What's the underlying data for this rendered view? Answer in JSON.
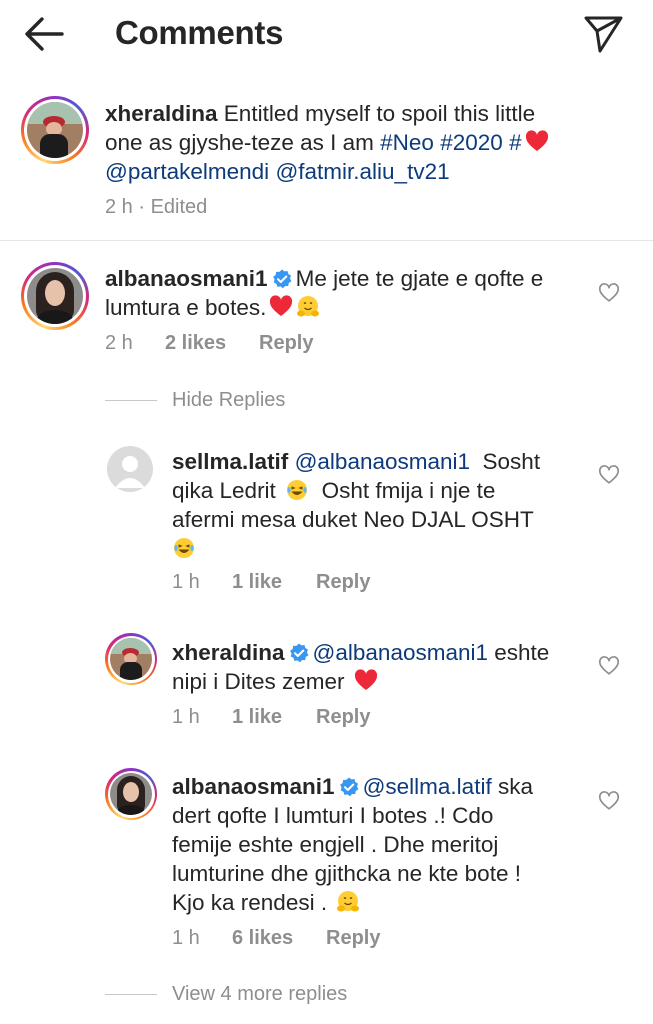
{
  "header": {
    "title": "Comments",
    "back_icon": "arrow-left-icon",
    "send_icon": "send-direct-icon"
  },
  "caption": {
    "username": "xheraldina",
    "text_part1": " Entitled myself to spoil this little",
    "text_line2_prefix": "one as gjyshe-teze as I am ",
    "hashtag1": "#Neo",
    "space": " ",
    "hashtag2": "#2020",
    "hashtag3": "#",
    "mention1": "@partakelmendi",
    "mention2": "@fatmir.aliu_tv21",
    "time": "2 h",
    "dot": " · ",
    "edited": "Edited"
  },
  "comments": [
    {
      "username": "albanaosmani1",
      "text_line1": "Me jete te gjate e qofte e",
      "text_line2": "lumtura e botes.",
      "time": "2 h",
      "likes": "2 likes",
      "reply": "Reply"
    }
  ],
  "replies_toggle": {
    "label": "Hide Replies"
  },
  "replies": [
    {
      "username": "sellma.latif",
      "mention": "@albanaosmani1",
      "line1_rest": "  Sosht",
      "line2": "qika Ledrit ",
      "line2_rest": "  Osht fmija i nje te",
      "line3": "afermi mesa duket Neo DJAL OSHT",
      "time": "1 h",
      "likes": "1 like",
      "reply": "Reply"
    },
    {
      "username": "xheraldina",
      "mention": "@albanaosmani1",
      "line1_rest": " eshte",
      "line2": "nipi i Dites zemer ",
      "time": "1 h",
      "likes": "1 like",
      "reply": "Reply"
    },
    {
      "username": "albanaosmani1",
      "mention": "@sellma.latif",
      "line1_rest": " ska",
      "line2": "dert qofte I lumturi I botes .! Cdo",
      "line3": "femije eshte engjell . Dhe meritoj",
      "line4": "lumturine dhe gjithcka ne kte bote !",
      "line5": "Kjo ka rendesi . ",
      "time": "1 h",
      "likes": "6 likes",
      "reply": "Reply"
    }
  ],
  "more_replies": {
    "label": "View 4 more replies"
  },
  "colors": {
    "hashtag": "#0d3a7a",
    "verified": "#3897f0",
    "meta": "#8e8e8e",
    "heart": "#ed2939"
  }
}
